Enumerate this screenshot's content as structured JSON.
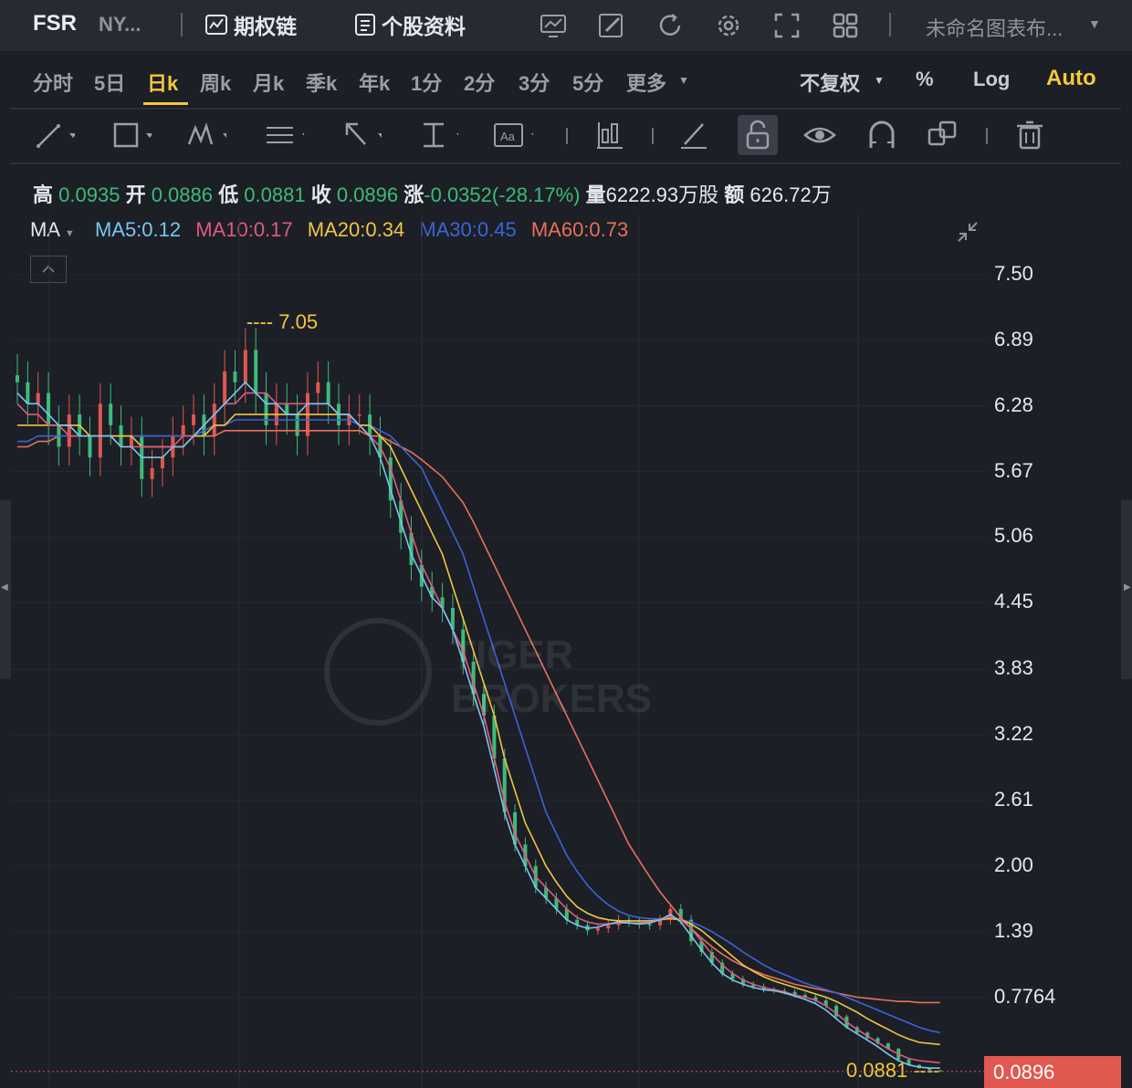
{
  "header": {
    "ticker": "FSR",
    "exchange": "NY...",
    "option_chain_label": "期权链",
    "stock_profile_label": "个股资料",
    "chart_name": "未命名图表布...",
    "icons": [
      "chart-layout-icon",
      "draw-icon",
      "refresh-icon",
      "settings-icon",
      "fullscreen-icon",
      "grid-layout-icon"
    ]
  },
  "periods": {
    "items": [
      "分时",
      "5日",
      "日k",
      "周k",
      "月k",
      "季k",
      "年k",
      "1分",
      "2分",
      "3分",
      "5分",
      "更多"
    ],
    "active": "日k",
    "adjust": "不复权",
    "percent": "%",
    "log": "Log",
    "auto": "Auto"
  },
  "quote": {
    "high_label": "高",
    "high": "0.0935",
    "open_label": "开",
    "open": "0.0886",
    "low_label": "低",
    "low": "0.0881",
    "close_label": "收",
    "close": "0.0896",
    "change_label": "涨",
    "change": "-0.0352(-28.17%)",
    "volume_label": "量",
    "volume": "6222.93万股",
    "amount_label": "额",
    "amount": "626.72万"
  },
  "ma": {
    "label": "MA",
    "ma5": "MA5:0.12",
    "ma10": "MA10:0.17",
    "ma20": "MA20:0.34",
    "ma30": "MA30:0.45",
    "ma60": "MA60:0.73",
    "colors": {
      "ma5": "#7cc4f0",
      "ma10": "#e05a7d",
      "ma20": "#f0c542",
      "ma30": "#3a64d8",
      "ma60": "#e8705a"
    }
  },
  "chart_data": {
    "type": "candlestick",
    "y_ticks": [
      "7.50",
      "6.89",
      "6.28",
      "5.67",
      "5.06",
      "4.45",
      "3.83",
      "3.22",
      "2.61",
      "2.00",
      "1.39",
      "0.7764"
    ],
    "ylim": [
      0.0881,
      7.5
    ],
    "max_annotation": "7.05",
    "min_annotation": "0.0881",
    "last_price": "0.0896",
    "up_color": "#e0584f",
    "down_color": "#3dbb7a",
    "close_series": [
      6.5,
      6.3,
      6.4,
      6.1,
      5.9,
      6.2,
      6.0,
      5.8,
      6.3,
      6.1,
      5.9,
      6.0,
      5.6,
      5.7,
      5.8,
      6.0,
      6.1,
      6.2,
      6.0,
      6.3,
      6.6,
      6.5,
      6.8,
      6.4,
      6.1,
      6.3,
      6.2,
      6.0,
      6.4,
      6.5,
      6.3,
      6.1,
      6.2,
      6.2,
      6.0,
      5.8,
      5.4,
      5.1,
      4.8,
      4.6,
      4.5,
      4.4,
      4.2,
      3.9,
      3.6,
      3.4,
      3.0,
      2.5,
      2.2,
      2.0,
      1.8,
      1.7,
      1.6,
      1.5,
      1.45,
      1.4,
      1.42,
      1.45,
      1.5,
      1.48,
      1.46,
      1.45,
      1.5,
      1.6,
      1.5,
      1.3,
      1.2,
      1.1,
      1.0,
      0.95,
      0.9,
      0.88,
      0.85,
      0.84,
      0.83,
      0.8,
      0.78,
      0.75,
      0.7,
      0.6,
      0.5,
      0.45,
      0.4,
      0.35,
      0.3,
      0.2,
      0.15,
      0.12,
      0.1,
      0.0896
    ],
    "ma5": [
      6.4,
      6.3,
      6.3,
      6.2,
      6.1,
      6.1,
      6.0,
      6.0,
      6.0,
      6.0,
      5.9,
      5.9,
      5.8,
      5.8,
      5.8,
      5.9,
      5.9,
      6.0,
      6.1,
      6.2,
      6.3,
      6.4,
      6.5,
      6.4,
      6.3,
      6.3,
      6.2,
      6.2,
      6.3,
      6.3,
      6.3,
      6.2,
      6.2,
      6.1,
      6.0,
      5.8,
      5.5,
      5.2,
      4.9,
      4.7,
      4.5,
      4.4,
      4.2,
      3.9,
      3.6,
      3.3,
      2.9,
      2.5,
      2.2,
      2.0,
      1.8,
      1.7,
      1.6,
      1.5,
      1.45,
      1.42,
      1.43,
      1.46,
      1.48,
      1.47,
      1.46,
      1.47,
      1.5,
      1.55,
      1.48,
      1.35,
      1.22,
      1.1,
      1.0,
      0.94,
      0.9,
      0.87,
      0.85,
      0.84,
      0.82,
      0.79,
      0.76,
      0.72,
      0.66,
      0.58,
      0.5,
      0.44,
      0.38,
      0.32,
      0.25,
      0.19,
      0.15,
      0.13,
      0.12,
      0.12
    ],
    "ma10": [
      6.3,
      6.2,
      6.2,
      6.1,
      6.1,
      6.0,
      6.0,
      6.0,
      6.0,
      6.0,
      5.9,
      5.9,
      5.9,
      5.9,
      5.9,
      5.9,
      6.0,
      6.0,
      6.1,
      6.2,
      6.3,
      6.3,
      6.4,
      6.4,
      6.4,
      6.3,
      6.3,
      6.3,
      6.3,
      6.3,
      6.3,
      6.2,
      6.2,
      6.1,
      6.0,
      5.9,
      5.7,
      5.4,
      5.1,
      4.8,
      4.6,
      4.4,
      4.2,
      4.0,
      3.7,
      3.4,
      3.0,
      2.6,
      2.3,
      2.1,
      1.9,
      1.8,
      1.7,
      1.6,
      1.52,
      1.48,
      1.46,
      1.46,
      1.47,
      1.47,
      1.47,
      1.48,
      1.5,
      1.53,
      1.5,
      1.42,
      1.3,
      1.18,
      1.08,
      1.0,
      0.94,
      0.9,
      0.87,
      0.85,
      0.83,
      0.8,
      0.78,
      0.75,
      0.7,
      0.63,
      0.55,
      0.48,
      0.42,
      0.36,
      0.3,
      0.25,
      0.21,
      0.19,
      0.18,
      0.17
    ],
    "ma20": [
      6.1,
      6.1,
      6.1,
      6.1,
      6.1,
      6.1,
      6.1,
      6.0,
      6.0,
      6.0,
      6.0,
      6.0,
      5.9,
      5.9,
      5.9,
      5.9,
      5.9,
      6.0,
      6.0,
      6.1,
      6.1,
      6.2,
      6.2,
      6.2,
      6.2,
      6.2,
      6.2,
      6.2,
      6.2,
      6.2,
      6.2,
      6.2,
      6.2,
      6.1,
      6.1,
      6.0,
      5.9,
      5.7,
      5.5,
      5.3,
      5.1,
      4.9,
      4.6,
      4.3,
      4.0,
      3.7,
      3.4,
      3.0,
      2.7,
      2.4,
      2.2,
      2.0,
      1.85,
      1.72,
      1.62,
      1.56,
      1.52,
      1.5,
      1.49,
      1.49,
      1.49,
      1.49,
      1.5,
      1.51,
      1.5,
      1.46,
      1.4,
      1.32,
      1.24,
      1.16,
      1.08,
      1.02,
      0.97,
      0.93,
      0.9,
      0.87,
      0.84,
      0.81,
      0.78,
      0.74,
      0.69,
      0.64,
      0.58,
      0.53,
      0.48,
      0.43,
      0.39,
      0.36,
      0.35,
      0.34
    ],
    "ma30": [
      5.95,
      5.95,
      6.0,
      6.0,
      6.0,
      6.0,
      6.0,
      6.0,
      6.0,
      6.0,
      6.0,
      6.0,
      6.0,
      6.0,
      6.0,
      6.0,
      6.0,
      6.0,
      6.05,
      6.1,
      6.1,
      6.15,
      6.15,
      6.15,
      6.15,
      6.15,
      6.15,
      6.15,
      6.15,
      6.15,
      6.15,
      6.15,
      6.15,
      6.1,
      6.1,
      6.05,
      6.0,
      5.9,
      5.8,
      5.7,
      5.5,
      5.3,
      5.1,
      4.9,
      4.6,
      4.3,
      4.0,
      3.7,
      3.4,
      3.1,
      2.8,
      2.5,
      2.3,
      2.1,
      1.95,
      1.82,
      1.72,
      1.64,
      1.58,
      1.54,
      1.52,
      1.51,
      1.51,
      1.51,
      1.5,
      1.48,
      1.44,
      1.39,
      1.33,
      1.27,
      1.2,
      1.14,
      1.08,
      1.03,
      0.99,
      0.95,
      0.91,
      0.88,
      0.85,
      0.82,
      0.78,
      0.74,
      0.7,
      0.66,
      0.62,
      0.58,
      0.54,
      0.5,
      0.47,
      0.45
    ],
    "ma60": [
      5.9,
      5.9,
      5.95,
      5.95,
      6.0,
      6.0,
      6.0,
      6.0,
      6.0,
      6.0,
      6.0,
      6.0,
      6.0,
      6.0,
      6.0,
      6.0,
      6.0,
      6.0,
      6.0,
      6.0,
      6.05,
      6.05,
      6.05,
      6.05,
      6.05,
      6.05,
      6.05,
      6.05,
      6.05,
      6.05,
      6.05,
      6.05,
      6.05,
      6.05,
      6.0,
      6.0,
      5.95,
      5.9,
      5.85,
      5.78,
      5.7,
      5.62,
      5.5,
      5.38,
      5.2,
      5.0,
      4.8,
      4.6,
      4.4,
      4.2,
      4.0,
      3.8,
      3.6,
      3.4,
      3.2,
      3.0,
      2.8,
      2.6,
      2.4,
      2.2,
      2.05,
      1.9,
      1.76,
      1.64,
      1.52,
      1.42,
      1.33,
      1.25,
      1.18,
      1.12,
      1.07,
      1.03,
      0.99,
      0.96,
      0.93,
      0.9,
      0.88,
      0.86,
      0.84,
      0.82,
      0.8,
      0.78,
      0.77,
      0.76,
      0.75,
      0.74,
      0.74,
      0.73,
      0.73,
      0.73
    ]
  }
}
